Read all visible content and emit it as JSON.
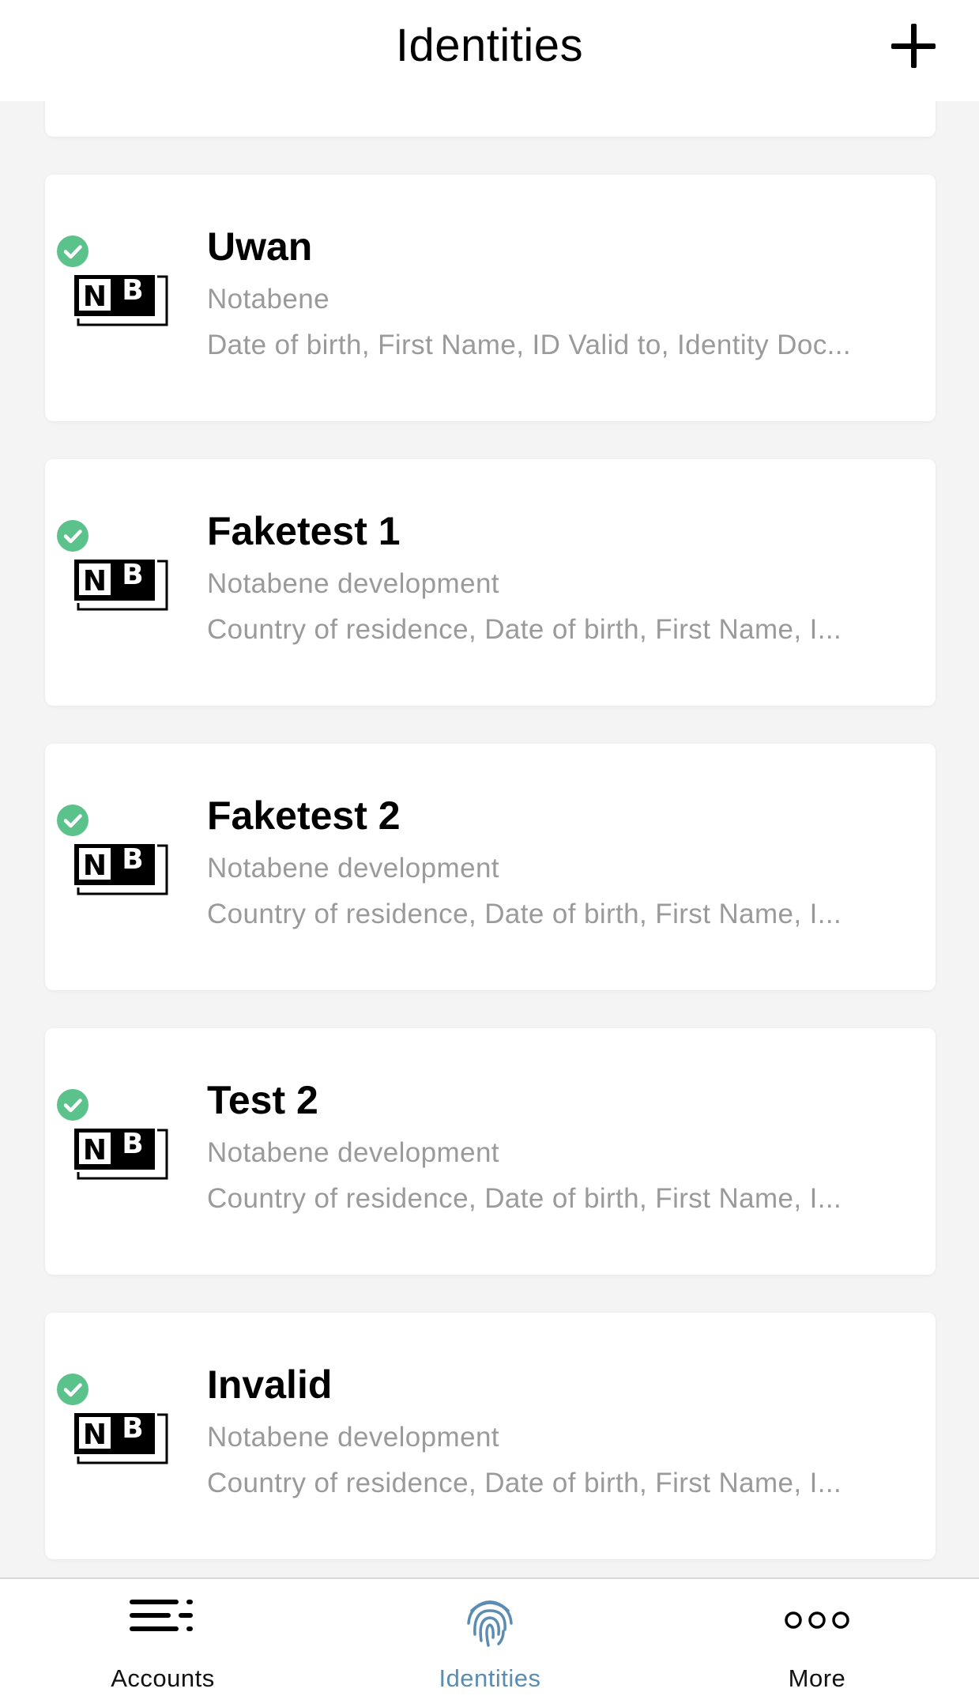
{
  "header": {
    "title": "Identities",
    "add_icon": "plus-icon"
  },
  "identities": [
    {
      "title": "Uwan",
      "issuer": "Notabene",
      "fields": "Date of birth, First Name, ID Valid to, Identity Doc...",
      "verified": true,
      "logo_text": "NB"
    },
    {
      "title": "Faketest 1",
      "issuer": "Notabene development",
      "fields": "Country of residence, Date of birth, First Name, I...",
      "verified": true,
      "logo_text": "NB"
    },
    {
      "title": "Faketest 2",
      "issuer": "Notabene development",
      "fields": "Country of residence, Date of birth, First Name, I...",
      "verified": true,
      "logo_text": "NB"
    },
    {
      "title": "Test 2",
      "issuer": "Notabene development",
      "fields": "Country of residence, Date of birth, First Name, I...",
      "verified": true,
      "logo_text": "NB"
    },
    {
      "title": "Invalid",
      "issuer": "Notabene development",
      "fields": "Country of residence, Date of birth, First Name, I...",
      "verified": true,
      "logo_text": "NB"
    }
  ],
  "tabbar": {
    "tabs": [
      {
        "label": "Accounts",
        "icon": "accounts-menu-icon",
        "active": false
      },
      {
        "label": "Identities",
        "icon": "fingerprint-icon",
        "active": true
      },
      {
        "label": "More",
        "icon": "more-dots-icon",
        "active": false
      }
    ]
  },
  "colors": {
    "verified_green": "#5cc28b",
    "active_tab": "#5b8db3",
    "secondary_text": "#9a9a9a",
    "background": "#f4f4f5"
  }
}
